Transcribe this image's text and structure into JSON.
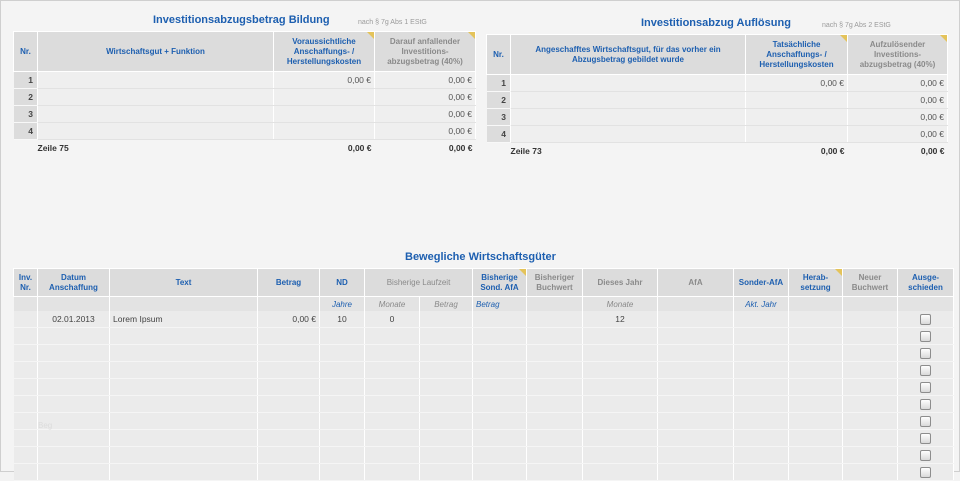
{
  "left": {
    "title": "Investitionsabzugsbetrag Bildung",
    "note": "nach § 7g Abs 1 EStG",
    "headers": {
      "nr": "Nr.",
      "wirtschaftsgut": "Wirtschaftsgut + Funktion",
      "kosten": "Voraussichtliche Anschaffungs- / Herstellungskosten",
      "abzug": "Darauf anfallender Investitions-abzugsbetrag (40%)"
    },
    "rows": [
      {
        "nr": "1",
        "kosten": "0,00 €",
        "abzug": "0,00 €"
      },
      {
        "nr": "2",
        "kosten": "",
        "abzug": "0,00 €"
      },
      {
        "nr": "3",
        "kosten": "",
        "abzug": "0,00 €"
      },
      {
        "nr": "4",
        "kosten": "",
        "abzug": "0,00 €"
      }
    ],
    "sum": {
      "label": "Zeile 75",
      "kosten": "0,00 €",
      "abzug": "0,00 €"
    }
  },
  "right": {
    "title": "Investitionsabzug Auflösung",
    "note": "nach § 7g Abs 2 EStG",
    "headers": {
      "nr": "Nr.",
      "wirtschaftsgut": "Angeschafftes Wirtschaftsgut, für das vorher ein Abzugsbetrag gebildet wurde",
      "kosten": "Tatsächliche Anschaffungs- / Herstellungskosten",
      "abzug": "Aufzulösender Investitions-abzugsbetrag (40%)"
    },
    "rows": [
      {
        "nr": "1",
        "kosten": "0,00 €",
        "abzug": "0,00 €"
      },
      {
        "nr": "2",
        "kosten": "",
        "abzug": "0,00 €"
      },
      {
        "nr": "3",
        "kosten": "",
        "abzug": "0,00 €"
      },
      {
        "nr": "4",
        "kosten": "",
        "abzug": "0,00 €"
      }
    ],
    "sum": {
      "label": "Zeile 73",
      "kosten": "0,00 €",
      "abzug": "0,00 €"
    }
  },
  "bottom": {
    "title": "Bewegliche Wirtschaftsgüter",
    "headers": {
      "inv_nr": "Inv. Nr.",
      "datum": "Datum Anschaffung",
      "text": "Text",
      "betrag": "Betrag",
      "nd": "ND",
      "bisherige_laufzeit": "Bisherige Laufzeit",
      "bisherige_sond": "Bisherige Sond. AfA",
      "bisheriger_buchwert": "Bisheriger Buchwert",
      "dieses_jahr": "Dieses Jahr",
      "afa": "AfA",
      "sonder_afa": "Sonder-AfA",
      "herabsetzung": "Herab-setzung",
      "neuer_buchwert": "Neuer Buchwert",
      "ausgeschieden": "Ausge-schieden"
    },
    "subheaders": {
      "nd": "Jahre",
      "monate": "Monate",
      "betrag": "Betrag",
      "sond_betrag": "Betrag",
      "dieses_jahr": "Monate",
      "sonder_afa": "Akt. Jahr"
    },
    "first_row": {
      "datum": "02.01.2013",
      "text": "Lorem Ipsum",
      "betrag": "0,00 €",
      "nd": "10",
      "monate": "0",
      "dieses_jahr": "12"
    },
    "empty_rows": 9,
    "ghost_text": "Beg"
  }
}
